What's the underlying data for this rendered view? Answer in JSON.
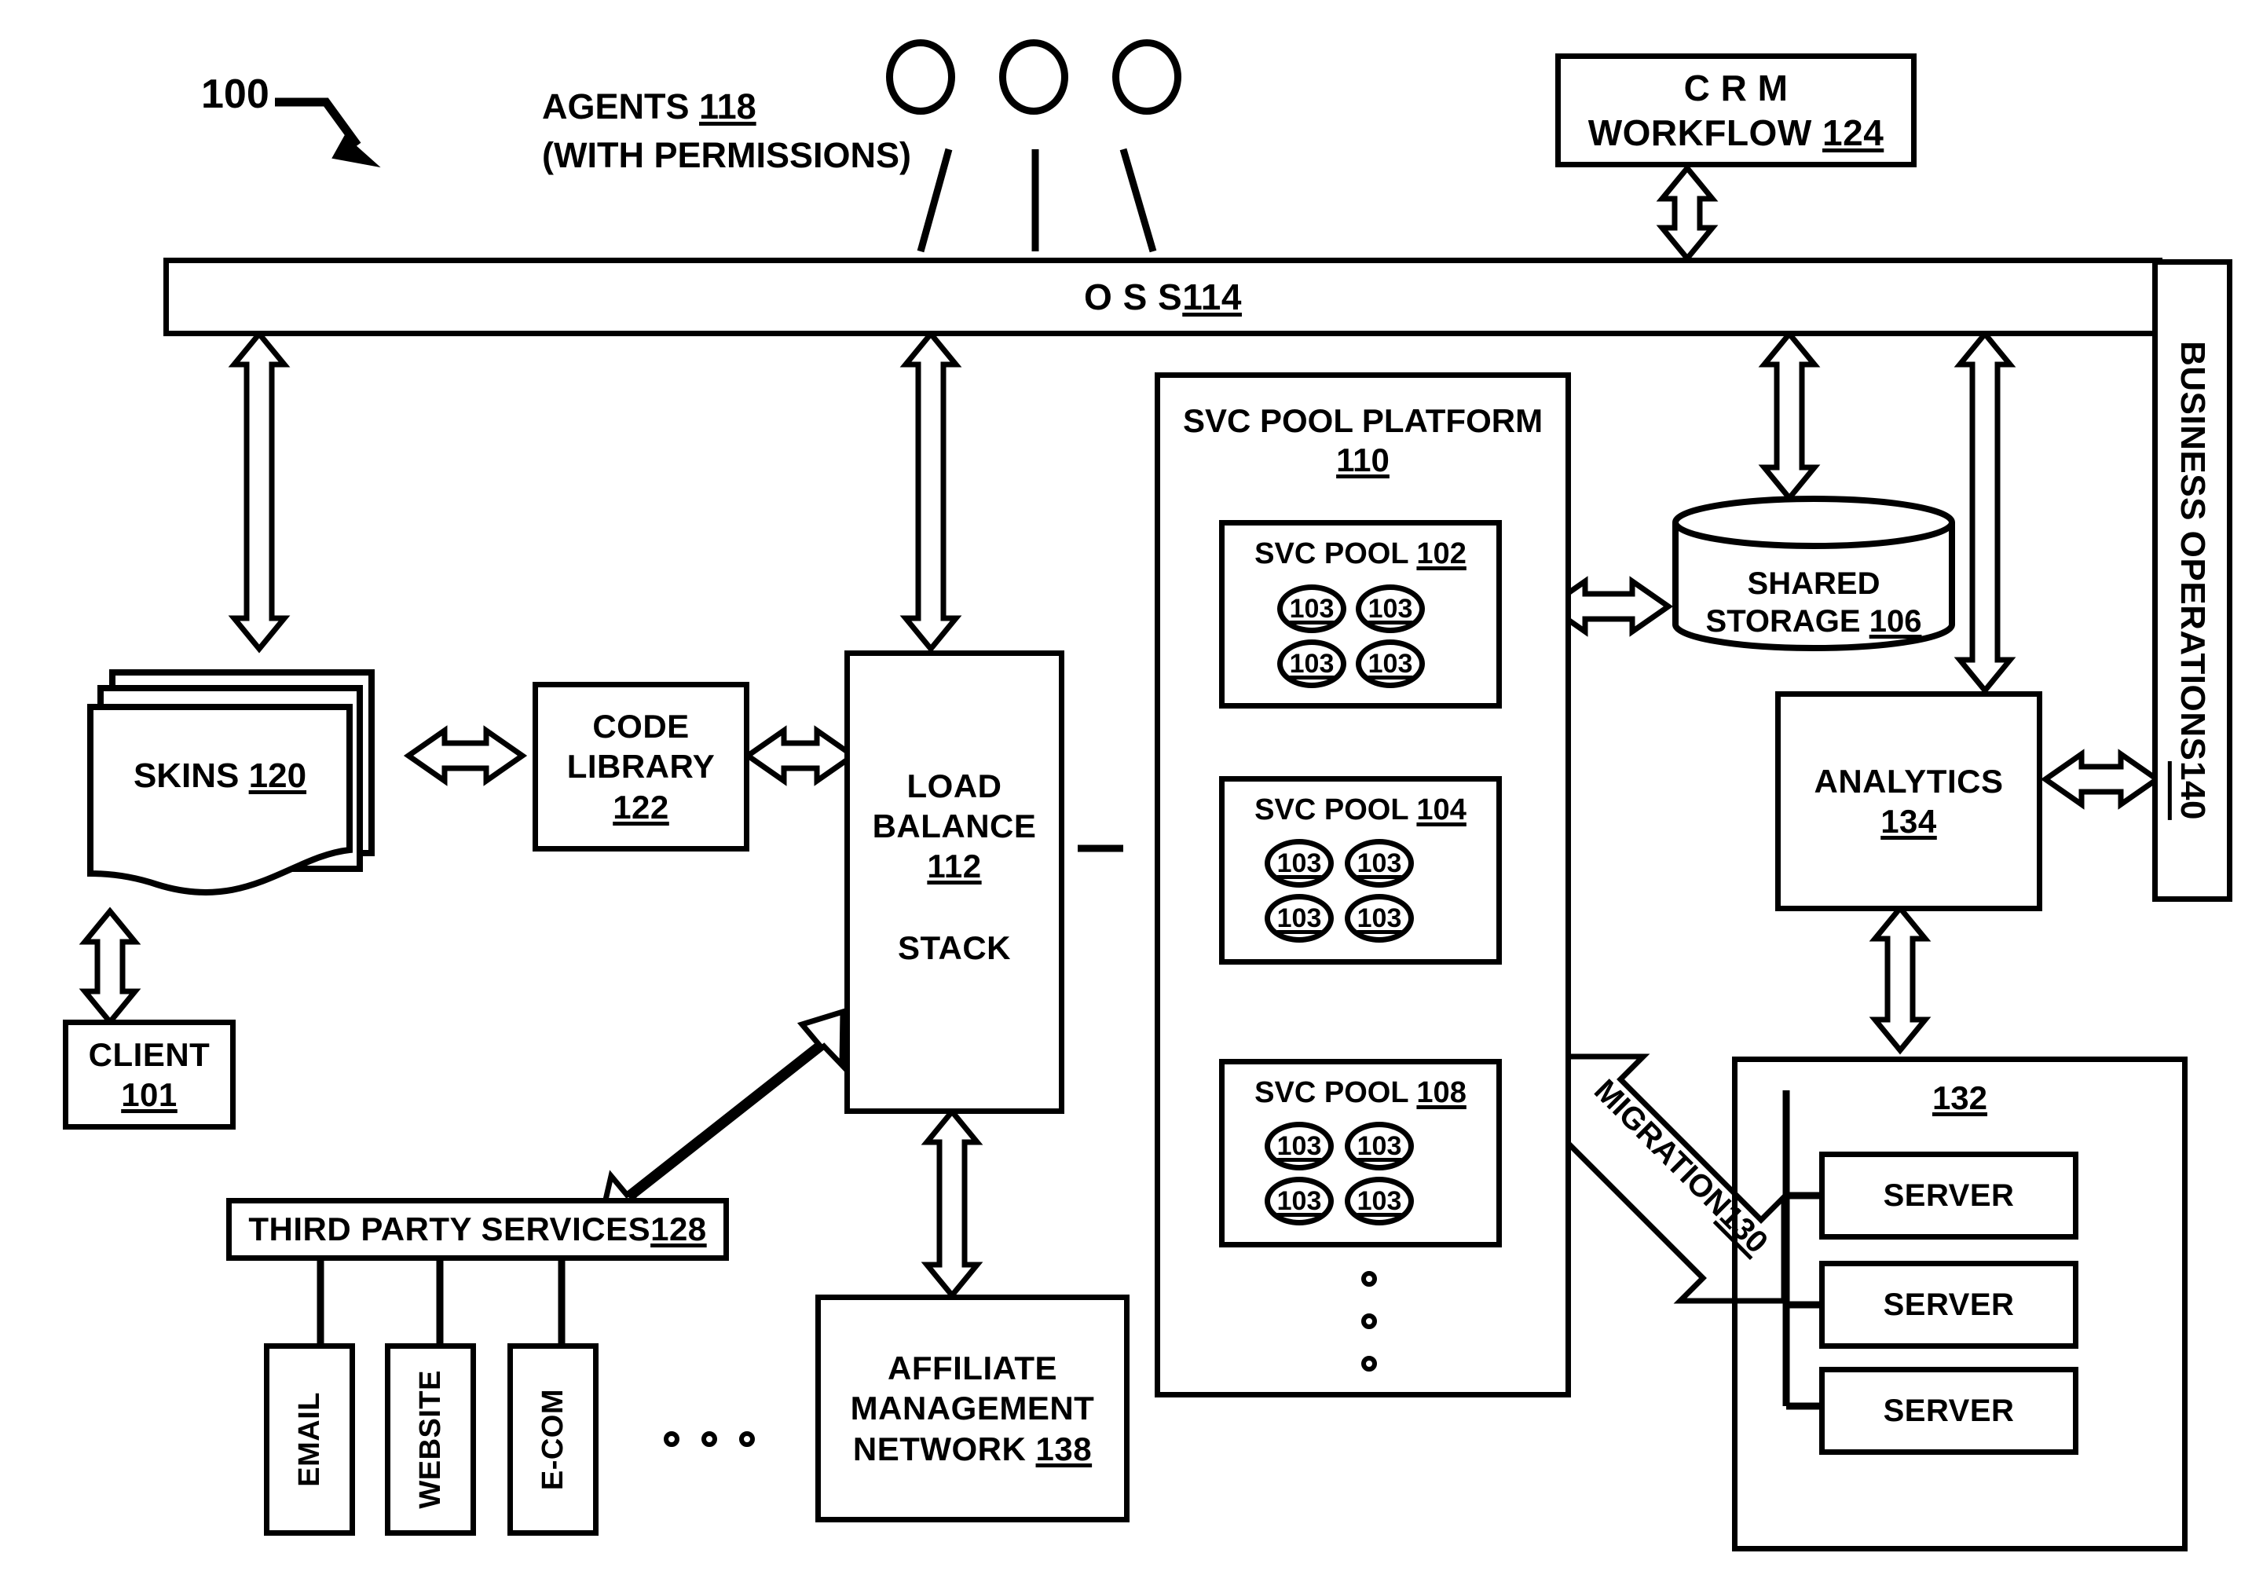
{
  "figure": {
    "reference_numeral": "100"
  },
  "agents": {
    "label_line1": "AGENTS ",
    "label_num": "118",
    "label_line2": "(WITH PERMISSIONS)",
    "count": 3
  },
  "crm": {
    "line1": "C R M",
    "line2": "WORKFLOW ",
    "num": "124"
  },
  "oss": {
    "label": "O S S ",
    "num": "114"
  },
  "business_ops": {
    "label": "BUSINESS OPERATIONS ",
    "num": "140"
  },
  "svc_pool_platform": {
    "title": "SVC POOL PLATFORM",
    "num": "110",
    "pools": [
      {
        "title": "SVC POOL ",
        "num": "102",
        "nodes": [
          "103",
          "103",
          "103",
          "103"
        ]
      },
      {
        "title": "SVC POOL ",
        "num": "104",
        "nodes": [
          "103",
          "103",
          "103",
          "103"
        ]
      },
      {
        "title": "SVC POOL ",
        "num": "108",
        "nodes": [
          "103",
          "103",
          "103",
          "103"
        ]
      }
    ],
    "ellipsis_dots": 3
  },
  "shared_storage": {
    "line1": "SHARED",
    "line2": "STORAGE ",
    "num": "106"
  },
  "analytics": {
    "label": "ANALYTICS",
    "num": "134"
  },
  "skins": {
    "label": "SKINS ",
    "num": "120"
  },
  "client": {
    "label": "CLIENT",
    "num": "101"
  },
  "code_library": {
    "line1": "CODE",
    "line2": "LIBRARY",
    "num": "122"
  },
  "load_balance": {
    "line1": "LOAD",
    "line2": "BALANCE",
    "num": "112",
    "line3": "STACK"
  },
  "third_party": {
    "label": "THIRD PARTY SERVICES ",
    "num": "128",
    "services": [
      "EMAIL",
      "WEBSITE",
      "E-COM"
    ],
    "ellipsis_dots": 3
  },
  "affiliate": {
    "line1": "AFFILIATE",
    "line2": "MANAGEMENT",
    "line3": "NETWORK ",
    "num": "138"
  },
  "migration": {
    "label": "MIGRATION ",
    "num": "130"
  },
  "server_group": {
    "num": "132",
    "servers": [
      "SERVER",
      "SERVER",
      "SERVER"
    ]
  },
  "colors": {
    "stroke": "#000000",
    "background": "#ffffff"
  }
}
